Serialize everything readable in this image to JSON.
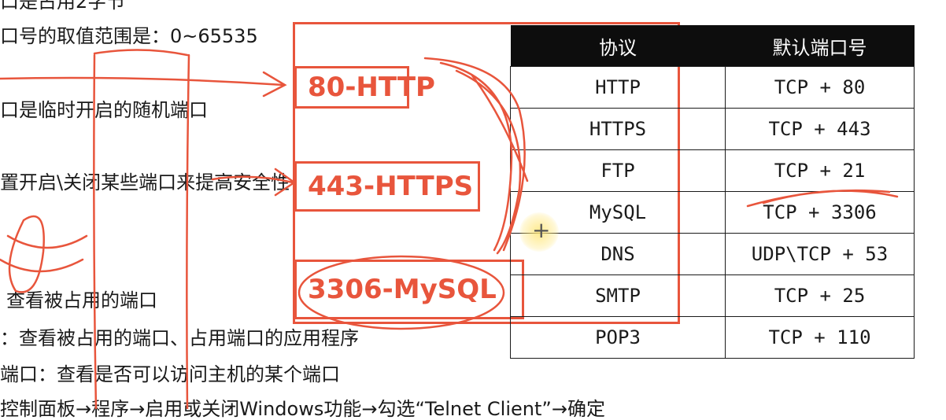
{
  "notes": {
    "line1": "口是占用2字节",
    "line2": "口号的取值范围是：0~65535",
    "line3": "口是临时开启的随机端口",
    "line4": "置开启\\关闭某些端口来提高安全性",
    "line5": "查看被占用的端口",
    "line6": "：查看被占用的端口、占用端口的应用程序",
    "line7": "端口：查看是否可以访问主机的某个端口",
    "line8": "控制面板→程序→启用或关闭Windows功能→勾选“Telnet Client”→确定"
  },
  "annotations": {
    "http": "80-HTTP",
    "https": "443-HTTPS",
    "mysql": "3306-MySQL"
  },
  "ports_table": {
    "headers": [
      "协议",
      "默认端口号"
    ],
    "rows": [
      [
        "HTTP",
        "TCP + 80"
      ],
      [
        "HTTPS",
        "TCP + 443"
      ],
      [
        "FTP",
        "TCP + 21"
      ],
      [
        "MySQL",
        "TCP + 3306"
      ],
      [
        "DNS",
        "UDP\\TCP + 53"
      ],
      [
        "SMTP",
        "TCP + 25"
      ],
      [
        "POP3",
        "TCP + 110"
      ]
    ]
  },
  "colors": {
    "ink": "#e8553c",
    "header_bg": "#0d0d0d"
  },
  "icons": {
    "cursor": "crosshair-cursor-icon"
  }
}
